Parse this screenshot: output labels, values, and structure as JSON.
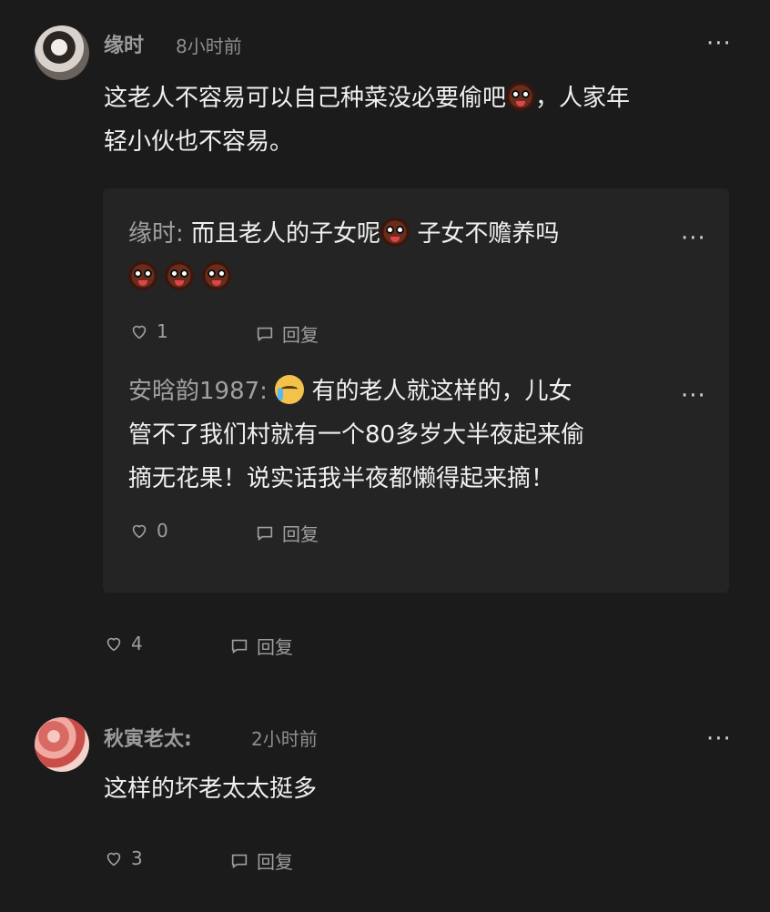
{
  "comments": [
    {
      "username": "缘时",
      "time": "8小时前",
      "text_line1_a": "这老人不容易可以自己种菜没必要偷吧",
      "text_line1_b": "，人家年",
      "text_line2": "轻小伙也不容易。",
      "likes": "4",
      "reply_label": "回复",
      "more": "···",
      "replies": [
        {
          "username": "缘时:",
          "text_line1_a": "而且老人的子女呢",
          "text_line1_b": "子女不赡养吗",
          "likes": "1",
          "reply_label": "回复",
          "more": "···"
        },
        {
          "username": "安晗韵1987:",
          "text_line1": "有的老人就这样的，儿女",
          "text_line2": "管不了我们村就有一个80多岁大半夜起来偷",
          "text_line3": "摘无花果！说实话我半夜都懒得起来摘！",
          "likes": "0",
          "reply_label": "回复",
          "more": "···"
        }
      ]
    },
    {
      "username": "秋寅老太:",
      "time": "2小时前",
      "text": "这样的坏老太太挺多",
      "likes": "3",
      "reply_label": "回复",
      "more": "···"
    }
  ],
  "icons": {
    "heart": "heart-icon",
    "comment": "comment-icon",
    "emoji_blush": "blushing-face-emoji",
    "emoji_cry": "crying-face-emoji"
  },
  "colors": {
    "background": "#1b1b1b",
    "reply_box": "#242424",
    "text": "#f0f0f0",
    "muted": "#9c9c9c"
  }
}
